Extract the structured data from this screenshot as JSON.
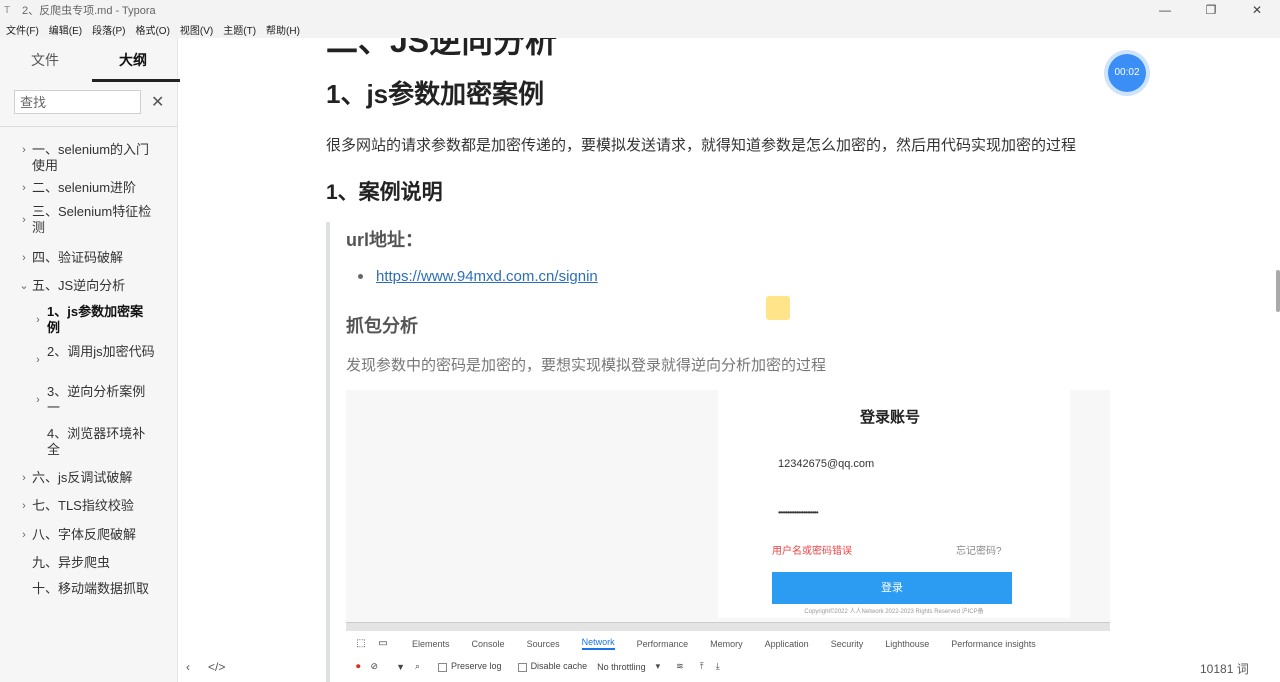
{
  "window": {
    "title": "2、反爬虫专项.md - Typora",
    "app_icon": "T",
    "controls": {
      "minimize": "—",
      "maximize": "❐",
      "close": "✕"
    }
  },
  "menu": [
    "文件(F)",
    "编辑(E)",
    "段落(P)",
    "格式(O)",
    "视图(V)",
    "主题(T)",
    "帮助(H)"
  ],
  "sidebar": {
    "tabs": {
      "files": "文件",
      "outline": "大纲"
    },
    "search_placeholder": "查找",
    "clear_icon": "✕",
    "items": [
      {
        "label": "一、selenium的入门使用",
        "arrow": "›"
      },
      {
        "label": "二、selenium进阶",
        "arrow": "›"
      },
      {
        "label": "三、Selenium特征检测",
        "arrow": "›"
      },
      {
        "label": "四、验证码破解",
        "arrow": "›"
      },
      {
        "label": "五、JS逆向分析",
        "arrow": "⌄"
      },
      {
        "label": "1、js参数加密案例",
        "arrow": "›"
      },
      {
        "label": "2、调用js加密代码",
        "arrow": "›"
      },
      {
        "label": "3、逆向分析案例一",
        "arrow": "›"
      },
      {
        "label": "4、浏览器环境补全",
        "arrow": ""
      },
      {
        "label": "六、js反调试破解",
        "arrow": "›"
      },
      {
        "label": "七、TLS指纹校验",
        "arrow": "›"
      },
      {
        "label": "八、字体反爬破解",
        "arrow": "›"
      },
      {
        "label": "九、异步爬虫",
        "arrow": ""
      },
      {
        "label": "十、移动端数据抓取",
        "arrow": ""
      }
    ],
    "bottom": {
      "toggle": "‹",
      "source": "</>"
    }
  },
  "content": {
    "cut_heading": "二、JS逆向分析",
    "h2": "1、js参数加密案例",
    "para": "很多网站的请求参数都是加密传递的，要模拟发送请求，就得知道参数是怎么加密的，然后用代码实现加密的过程",
    "h3": "1、案例说明",
    "quote": {
      "h4_url": "url地址：",
      "link": "https://www.94mxd.com.cn/signin",
      "h4_capture": "抓包分析",
      "para": "发现参数中的密码是加密的，要想实现模拟登录就得逆向分析加密的过程"
    },
    "screenshot": {
      "login_title": "登录账号",
      "email": "12342675@qq.com",
      "password": "••••••••••••••••••••••",
      "error": "用户名或密码错误",
      "forgot": "忘记密码?",
      "button": "登录",
      "copyright": "Copyright©2022 人人Network 2022-2023 Rights Reserved 沪ICP备",
      "devtools_tabs": [
        "Elements",
        "Console",
        "Sources",
        "Network",
        "Performance",
        "Memory",
        "Application",
        "Security",
        "Lighthouse",
        "Performance insights"
      ],
      "devtools_tools": {
        "preserve": "Preserve log",
        "disable_cache": "Disable cache",
        "throttling": "No throttling"
      }
    }
  },
  "timer": "00:02",
  "word_count": "10181 词"
}
